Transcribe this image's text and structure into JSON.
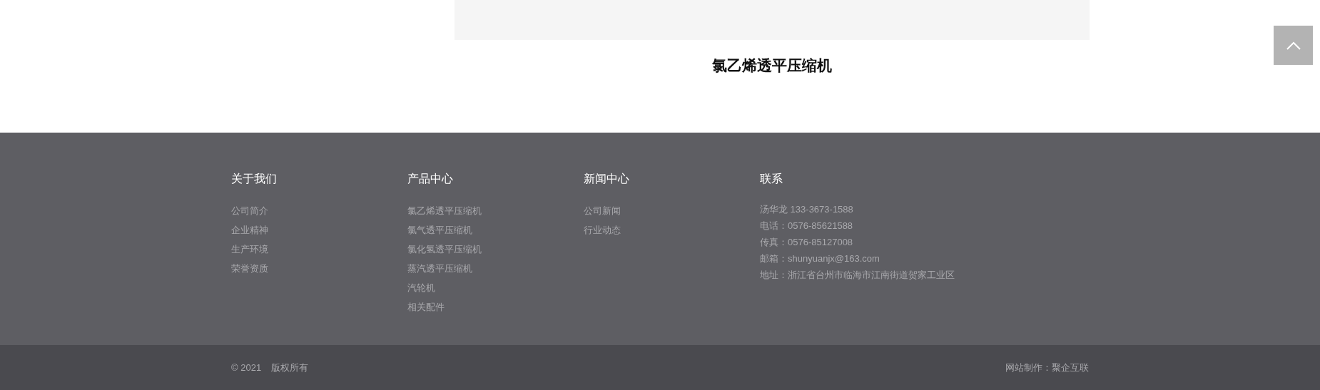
{
  "product": {
    "title": "氯乙烯透平压缩机"
  },
  "footer": {
    "columns": [
      {
        "heading": "关于我们",
        "items": [
          "公司简介",
          "企业精神",
          "生产环境",
          "荣誉资质"
        ]
      },
      {
        "heading": "产品中心",
        "items": [
          "氯乙烯透平压缩机",
          "氯气透平压缩机",
          "氯化氢透平压缩机",
          "蒸汽透平压缩机",
          "汽轮机",
          "相关配件"
        ]
      },
      {
        "heading": "新闻中心",
        "items": [
          "公司新闻",
          "行业动态"
        ]
      }
    ],
    "contact": {
      "heading": "联系",
      "lines": [
        "汤华龙 133-3673-1588",
        "电话：0576-85621588",
        "传真：0576-85127008",
        "邮箱：shunyuanjx@163.com",
        "地址：浙江省台州市临海市江南街道贺家工业区"
      ]
    }
  },
  "bottom_bar": {
    "copyright": "© 2021",
    "rights": "版权所有",
    "credit": "网站制作：聚企互联"
  }
}
